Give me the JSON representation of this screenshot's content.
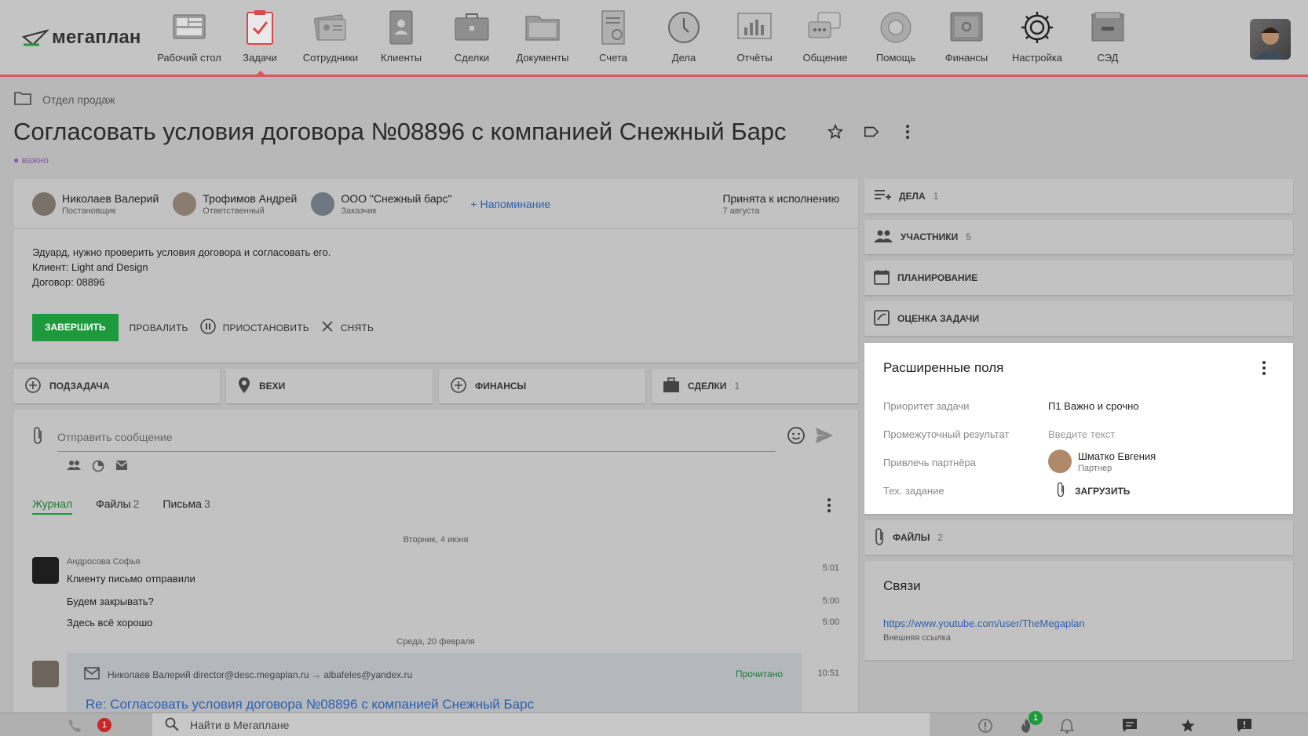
{
  "app": {
    "logo_text": "мегаплан"
  },
  "nav": [
    {
      "label": "Рабочий стол",
      "icon": "desktop-icon"
    },
    {
      "label": "Задачи",
      "icon": "tasks-icon"
    },
    {
      "label": "Сотрудники",
      "icon": "employees-icon"
    },
    {
      "label": "Клиенты",
      "icon": "clients-icon"
    },
    {
      "label": "Сделки",
      "icon": "deals-icon"
    },
    {
      "label": "Документы",
      "icon": "documents-icon"
    },
    {
      "label": "Счета",
      "icon": "invoices-icon"
    },
    {
      "label": "Дела",
      "icon": "clock-icon"
    },
    {
      "label": "Отчёты",
      "icon": "reports-icon"
    },
    {
      "label": "Общение",
      "icon": "chat-icon"
    },
    {
      "label": "Помощь",
      "icon": "lifebuoy-icon"
    },
    {
      "label": "Финансы",
      "icon": "safe-icon"
    },
    {
      "label": "Настройка",
      "icon": "gear-icon"
    },
    {
      "label": "СЭД",
      "icon": "archive-icon"
    }
  ],
  "breadcrumb": "Отдел продаж",
  "title": "Согласовать условия договора №08896 с компанией Снежный Барс",
  "tag": "● важно",
  "people": [
    {
      "name": "Николаев Валерий",
      "role": "Постановщик"
    },
    {
      "name": "Трофимов Андрей",
      "role": "Ответственный"
    },
    {
      "name": "ООО \"Снежный барс\"",
      "role": "Заказчик"
    }
  ],
  "reminder": "+ Напоминание",
  "status": {
    "label": "Принята к исполнению",
    "date": "7 августа"
  },
  "description": [
    "Эдуард, нужно проверить условия договора и согласовать его.",
    "Клиент: Light and Design",
    "Договор: 08896"
  ],
  "actions": {
    "finish": "ЗАВЕРШИТЬ",
    "fail": "ПРОВАЛИТЬ",
    "pause": "ПРИОСТАНОВИТЬ",
    "remove": "СНЯТЬ"
  },
  "sub_buttons": [
    {
      "label": "ПОДЗАДАЧА",
      "count": ""
    },
    {
      "label": "ВЕХИ",
      "count": ""
    },
    {
      "label": "ФИНАНСЫ",
      "count": ""
    },
    {
      "label": "СДЕЛКИ",
      "count": "1"
    }
  ],
  "message": {
    "placeholder": "Отправить сообщение"
  },
  "tabs": [
    {
      "label": "Журнал",
      "count": ""
    },
    {
      "label": "Файлы",
      "count": "2"
    },
    {
      "label": "Письма",
      "count": "3"
    }
  ],
  "feed": {
    "date1": "Вторник, 4 июня",
    "author": "Андросова Софья",
    "msgs": [
      {
        "text": "Клиенту письмо отправили",
        "time": "5:01"
      },
      {
        "text": "Будем закрывать?",
        "time": "5:00"
      },
      {
        "text": "Здесь всё хорошо",
        "time": "5:00"
      }
    ],
    "date2": "Среда, 20 февраля",
    "mail_head": "Николаев Валерий director@desc.megaplan.ru → albafeles@yandex.ru",
    "mail_status": "Прочитано",
    "mail_time": "10:51",
    "mail_subject": "Re: Согласовать условия договора №08896 с компанией Снежный Барс"
  },
  "right": {
    "deals": {
      "label": "ДЕЛА",
      "count": "1"
    },
    "participants": {
      "label": "УЧАСТНИКИ",
      "count": "5"
    },
    "planning": {
      "label": "ПЛАНИРОВАНИЕ"
    },
    "rating": {
      "label": "ОЦЕНКА ЗАДАЧИ"
    },
    "files": {
      "label": "ФАЙЛЫ",
      "count": "2"
    }
  },
  "extended": {
    "title": "Расширенные поля",
    "priority_label": "Приоритет задачи",
    "priority_value": "П1 Важно и срочно",
    "interim_label": "Промежуточный результат",
    "interim_placeholder": "Введите текст",
    "partner_label": "Привлечь партнёра",
    "partner_name": "Шматко Евгения",
    "partner_role": "Партнер",
    "spec_label": "Тех. задание",
    "upload": "ЗАГРУЗИТЬ"
  },
  "links": {
    "title": "Связи",
    "url": "https://www.youtube.com/user/TheMegaplan",
    "caption": "Внешняя ссылка"
  },
  "bottom": {
    "search": "Найти в Мегаплане",
    "calls_badge": "1",
    "fire_badge": "1"
  }
}
